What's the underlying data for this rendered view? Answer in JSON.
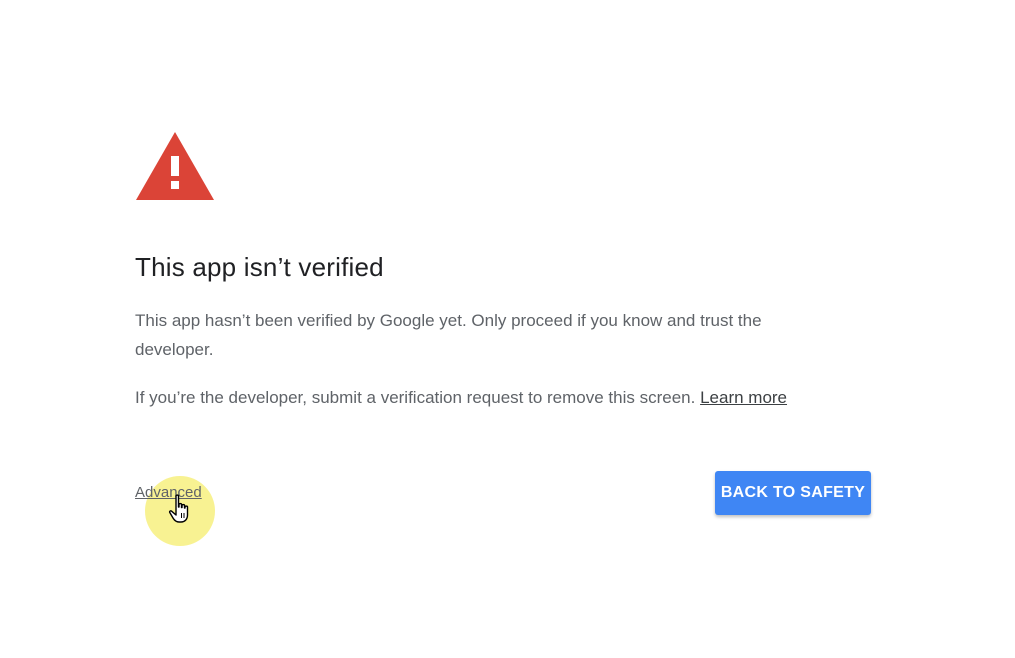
{
  "icons": {
    "warning": "warning-triangle-icon",
    "cursor": "hand-pointer-icon"
  },
  "colors": {
    "warning_red": "#db4437",
    "button_blue": "#3f86f4",
    "cursor_highlight": "#f5ee6e"
  },
  "main": {
    "title": "This app isn’t verified",
    "paragraph_1": "This app hasn’t been verified by Google yet. Only proceed if you know and trust the developer.",
    "paragraph_2": "If you’re the developer, submit a verification request to remove this screen.",
    "learn_more_label": "Learn more"
  },
  "actions": {
    "advanced_label": "Advanced",
    "back_to_safety_label": "BACK TO SAFETY"
  }
}
